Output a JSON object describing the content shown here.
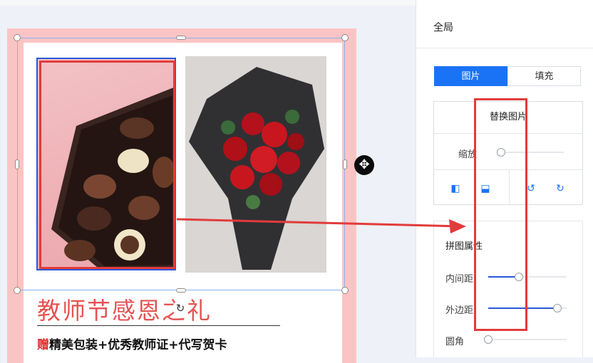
{
  "poster": {
    "title": "教师节感恩之礼",
    "subtitle_prefix": "赠",
    "subtitle_rest": "精美包装+优秀教师证+代写贺卡"
  },
  "panel": {
    "title": "全局",
    "tabs": [
      {
        "label": "图片",
        "active": true
      },
      {
        "label": "填充",
        "active": false
      }
    ],
    "replace_image_label": "替换图片",
    "scale_label": "缩放",
    "scale_value": 0.0,
    "collage_props_title": "拼图属性",
    "padding_label": "内间距",
    "padding_value": 0.39,
    "margin_label": "外边距",
    "margin_value": 0.88,
    "radius_label": "圆角",
    "radius_value": 0.0,
    "icons": [
      "flip-horizontal-icon",
      "flip-vertical-icon",
      "rotate-left-icon",
      "rotate-right-icon"
    ]
  },
  "colors": {
    "accent": "#1a73f5",
    "slider_fill": "#2a58d8",
    "annotation_red": "#e23b3b",
    "poster_bg": "#fbc4c4",
    "poster_title": "#e55353"
  }
}
